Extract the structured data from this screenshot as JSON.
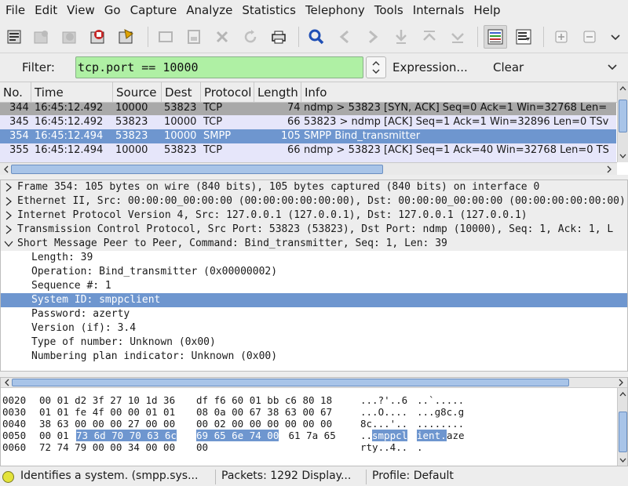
{
  "menu": [
    "File",
    "Edit",
    "View",
    "Go",
    "Capture",
    "Analyze",
    "Statistics",
    "Telephony",
    "Tools",
    "Internals",
    "Help"
  ],
  "filter": {
    "label": "Filter:",
    "value": "tcp.port == 10000",
    "expression_label": "Expression...",
    "clear_label": "Clear",
    "color": "#aff0a4"
  },
  "packet_list": {
    "columns": [
      "No.",
      "Time",
      "Source",
      "Dest",
      "Protocol",
      "Length",
      "Info"
    ],
    "rows": [
      {
        "no": "344",
        "time": "16:45:12.492",
        "src": "10000",
        "dst": "53823",
        "proto": "TCP",
        "len": "74",
        "info": "ndmp > 53823 [SYN, ACK] Seq=0 Ack=1 Win=32768 Len=",
        "style": "gray"
      },
      {
        "no": "345",
        "time": "16:45:12.492",
        "src": "53823",
        "dst": "10000",
        "proto": "TCP",
        "len": "66",
        "info": "53823 > ndmp [ACK] Seq=1 Ack=1 Win=32896 Len=0 TSv",
        "style": "lav"
      },
      {
        "no": "354",
        "time": "16:45:12.494",
        "src": "53823",
        "dst": "10000",
        "proto": "SMPP",
        "len": "105",
        "info": "SMPP Bind_transmitter",
        "style": "sel"
      },
      {
        "no": "355",
        "time": "16:45:12.494",
        "src": "10000",
        "dst": "53823",
        "proto": "TCP",
        "len": "66",
        "info": "ndmp > 53823 [ACK] Seq=1 Ack=40 Win=32768 Len=0 TS",
        "style": "lav"
      }
    ]
  },
  "details": {
    "frame": "Frame 354: 105 bytes on wire (840 bits), 105 bytes captured (840 bits) on interface 0",
    "ethernet": "Ethernet II, Src: 00:00:00_00:00:00 (00:00:00:00:00:00), Dst: 00:00:00_00:00:00 (00:00:00:00:00:00)",
    "ip": "Internet Protocol Version 4, Src: 127.0.0.1 (127.0.0.1), Dst: 127.0.0.1 (127.0.0.1)",
    "tcp": "Transmission Control Protocol, Src Port: 53823 (53823), Dst Port: ndmp (10000), Seq: 1, Ack: 1, L",
    "smpp": "Short Message Peer to Peer, Command: Bind_transmitter, Seq: 1, Len: 39",
    "fields": [
      {
        "text": "Length: 39",
        "selected": false
      },
      {
        "text": "Operation: Bind_transmitter (0x00000002)",
        "selected": false
      },
      {
        "text": "Sequence #: 1",
        "selected": false
      },
      {
        "text": "System ID: smppclient",
        "selected": true
      },
      {
        "text": "Password: azerty",
        "selected": false
      },
      {
        "text": "Version (if): 3.4",
        "selected": false
      },
      {
        "text": "Type of number: Unknown (0x00)",
        "selected": false
      },
      {
        "text": "Numbering plan indicator: Unknown (0x00)",
        "selected": false
      }
    ]
  },
  "hex": {
    "rows": [
      {
        "off": "0020",
        "h1": "00 01 d2 3f 27 10 1d 36",
        "h2": "df f6 60 01 bb c6 80 18",
        "a1": "...?'..6",
        "a2": "..`....."
      },
      {
        "off": "0030",
        "h1": "01 01 fe 4f 00 00 01 01",
        "h2": "08 0a 00 67 38 63 00 67",
        "a1": "...O....",
        "a2": "...g8c.g"
      },
      {
        "off": "0040",
        "h1": "38 63 00 00 00 27 00 00",
        "h2": "00 02 00 00 00 00 00 00",
        "a1": "8c...'..",
        "a2": "........"
      },
      {
        "off": "0050",
        "h1a": "00 01 ",
        "h1b": "73 6d 70 70 63 6c",
        "h2a": "69 65 6e 74 00",
        "h2b": " 61 7a 65",
        "a1a": "..",
        "a1b": "smppcl",
        "a2a": "ient.",
        "a2b": "aze"
      },
      {
        "off": "0060",
        "h1": "72 74 79 00 00 34 00 00",
        "h2": "00",
        "a1": "rty..4..",
        "a2": "."
      }
    ]
  },
  "status": {
    "message": "Identifies a system. (smpp.sys...",
    "packets": "Packets: 1292 Display...",
    "profile": "Profile: Default"
  },
  "colors": {
    "selected": "#6e96cf",
    "lavender": "#e6e6fa",
    "gray_row": "#a9a9a9",
    "filter_valid": "#aff0a4"
  }
}
